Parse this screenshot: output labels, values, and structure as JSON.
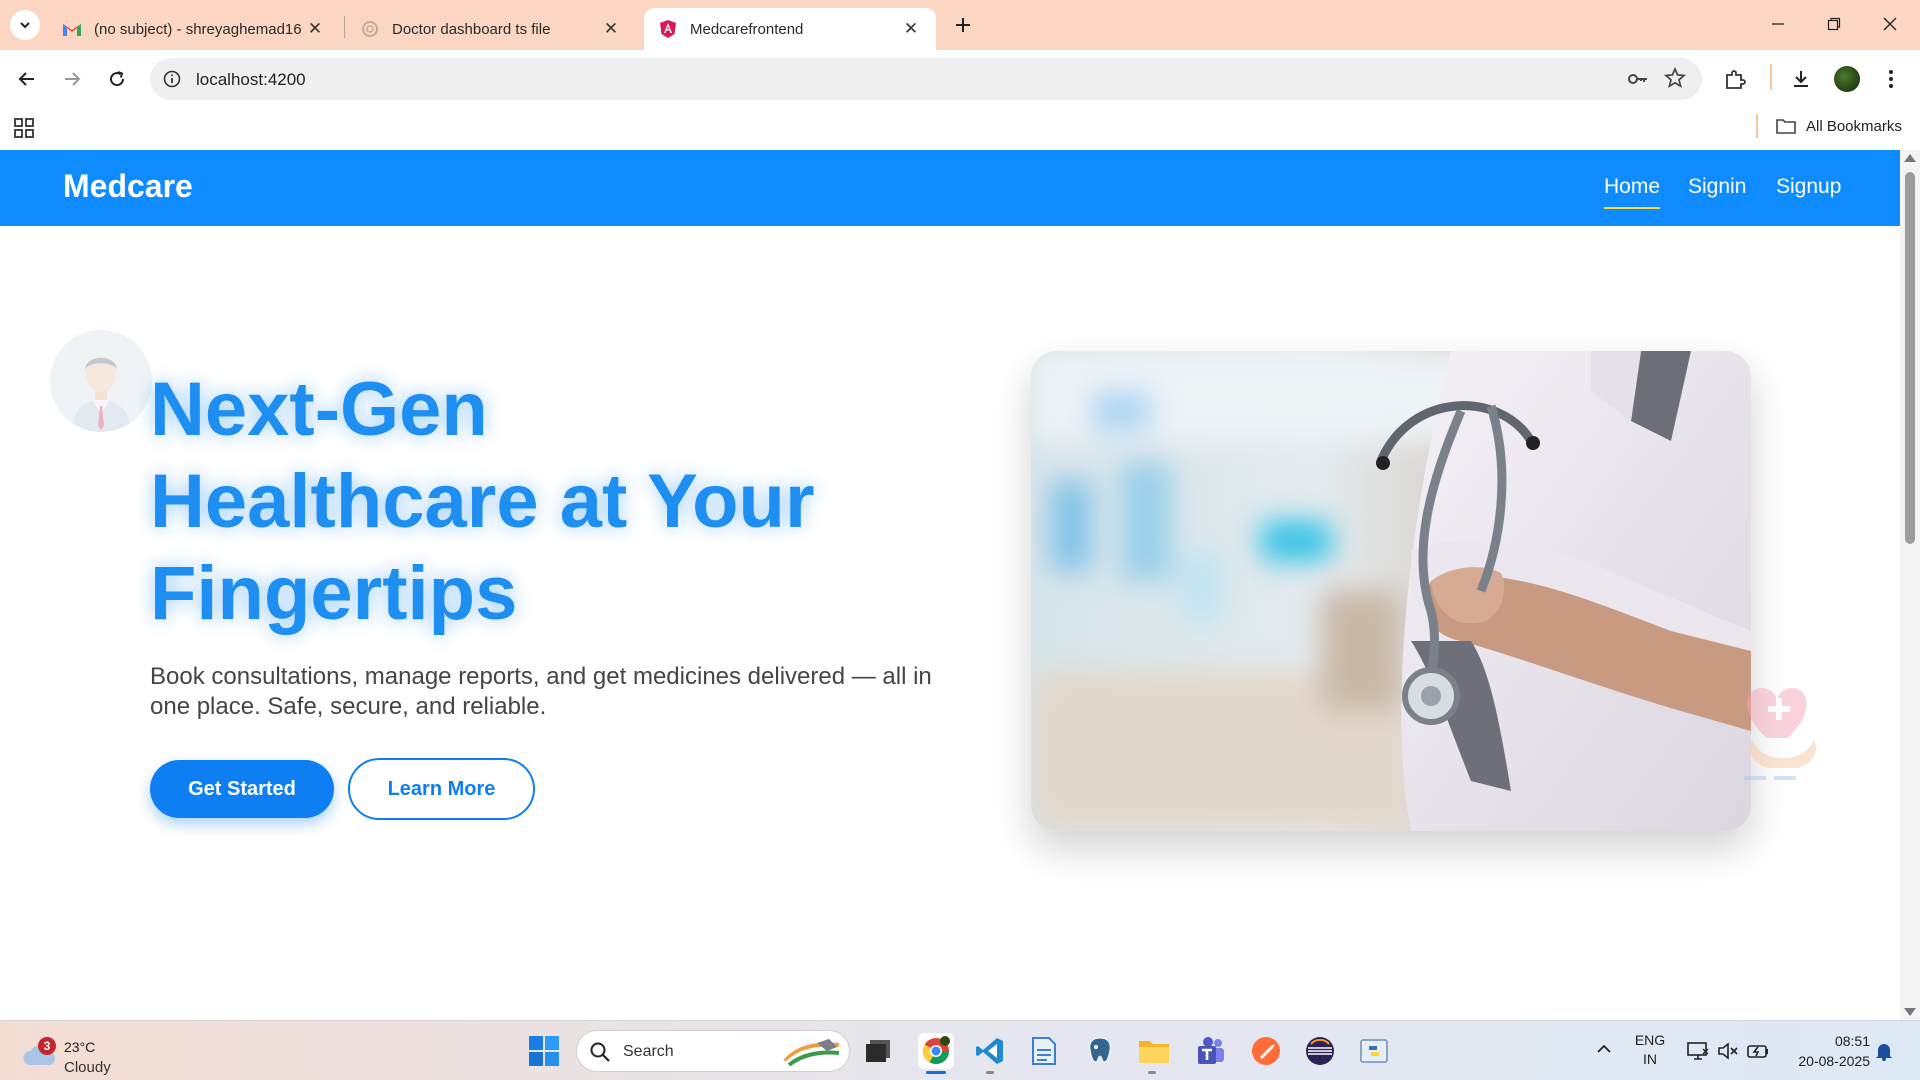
{
  "browser": {
    "tabs": [
      {
        "title": "(no subject) - shreyaghemad16",
        "favicon": "gmail-icon",
        "active": false
      },
      {
        "title": "Doctor dashboard ts file",
        "favicon": "chatgpt-icon",
        "active": false
      },
      {
        "title": "Medcarefrontend",
        "favicon": "angular-icon",
        "active": true
      }
    ],
    "url": "localhost:4200",
    "bookmarks_label": "All Bookmarks",
    "colors": {
      "tabstrip": "#fbd7c3",
      "omnibox": "#efefef"
    }
  },
  "site": {
    "brand": "Medcare",
    "nav": {
      "home": "Home",
      "signin": "Signin",
      "signup": "Signup"
    },
    "hero": {
      "title_line1": "Next-Gen",
      "title_line2": "Healthcare at Your",
      "title_line3": "Fingertips",
      "subtitle": "Book consultations, manage reports, and get medicines delivered — all in one place. Safe, secure, and reliable.",
      "primary_cta": "Get Started",
      "secondary_cta": "Learn More"
    },
    "colors": {
      "primary": "#0d8bff",
      "heading": "#1f8ef1",
      "nav_underline": "#ffd54a"
    }
  },
  "taskbar": {
    "weather": {
      "badge": "3",
      "temperature": "23°C",
      "condition": "Cloudy"
    },
    "search_label": "Search",
    "language": {
      "line1": "ENG",
      "line2": "IN"
    },
    "time": "08:51",
    "date": "20-08-2025",
    "apps": [
      "windows-start-icon",
      "file-explorer-task-icon",
      "chrome-icon",
      "vscode-icon",
      "notepad-icon",
      "postgres-icon",
      "folder-icon",
      "teams-icon",
      "postman-icon",
      "eclipse-icon",
      "python-icon"
    ]
  }
}
